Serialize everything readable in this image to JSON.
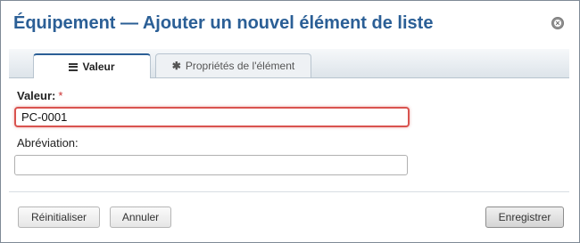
{
  "dialog": {
    "title": "Équipement — Ajouter un nouvel élément de liste",
    "close_icon": "close-circle-icon"
  },
  "tabs": [
    {
      "label": "Valeur",
      "icon": "list-icon",
      "active": true
    },
    {
      "label": "Propriétés de l'élément",
      "icon": "asterisk-icon",
      "active": false
    }
  ],
  "form": {
    "value_label": "Valeur:",
    "value_required_marker": "*",
    "value_input": "PC-0001",
    "abbrev_label": "Abréviation:",
    "abbrev_input": ""
  },
  "buttons": {
    "reset": "Réinitialiser",
    "cancel": "Annuler",
    "save": "Enregistrer"
  },
  "colors": {
    "title": "#2b5f96",
    "error_border": "#d9534f",
    "required": "#cc3333"
  }
}
